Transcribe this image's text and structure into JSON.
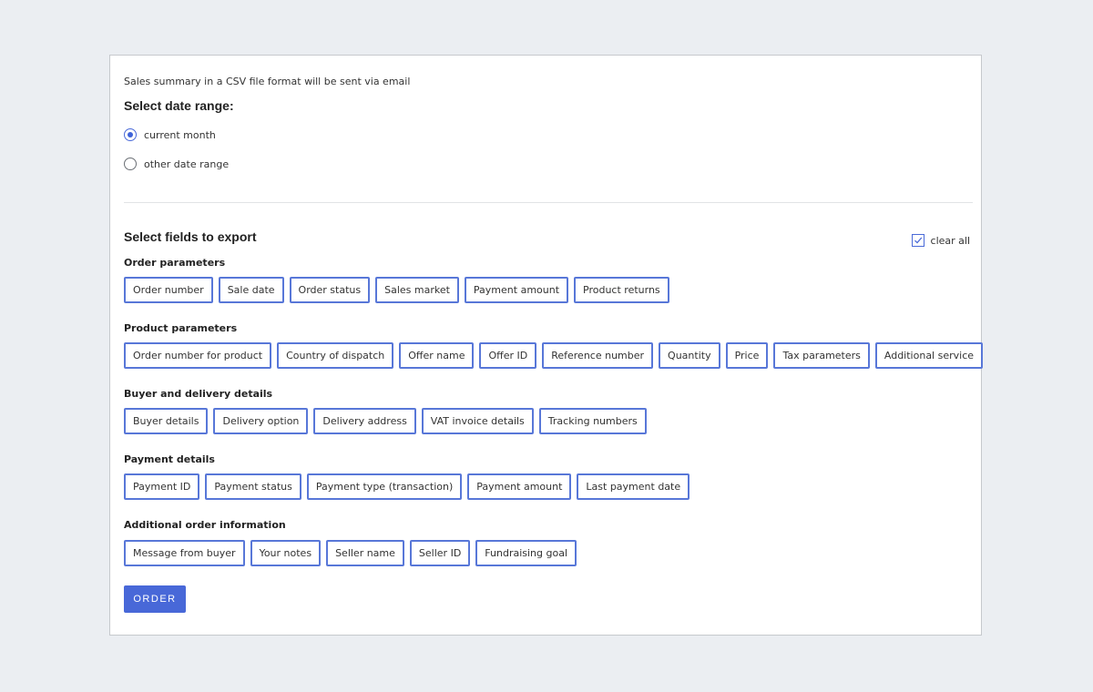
{
  "intro_text": "Sales summary in a CSV file format will be sent via email",
  "date_range": {
    "title": "Select date range:",
    "options": [
      {
        "label": "current month",
        "checked": true
      },
      {
        "label": "other date range",
        "checked": false
      }
    ]
  },
  "export": {
    "title": "Select fields to export",
    "clear_all_label": "clear all",
    "clear_all_checked": true,
    "groups": [
      {
        "title": "Order parameters",
        "fields": [
          "Order number",
          "Sale date",
          "Order status",
          "Sales market",
          "Payment amount",
          "Product returns"
        ]
      },
      {
        "title": "Product parameters",
        "fields": [
          "Order number for product",
          "Country of dispatch",
          "Offer name",
          "Offer ID",
          "Reference number",
          "Quantity",
          "Price",
          "Tax parameters",
          "Additional service"
        ]
      },
      {
        "title": "Buyer and delivery details",
        "fields": [
          "Buyer details",
          "Delivery option",
          "Delivery address",
          "VAT invoice details",
          "Tracking numbers"
        ]
      },
      {
        "title": "Payment details",
        "fields": [
          "Payment ID",
          "Payment status",
          "Payment type (transaction)",
          "Payment amount",
          "Last payment date"
        ]
      },
      {
        "title": "Additional order information",
        "fields": [
          "Message from buyer",
          "Your notes",
          "Seller name",
          "Seller ID",
          "Fundraising goal"
        ]
      }
    ]
  },
  "order_button_label": "ORDER",
  "colors": {
    "accent": "#4868d8",
    "chip_border": "#5877d8",
    "background": "#ebeef2"
  }
}
